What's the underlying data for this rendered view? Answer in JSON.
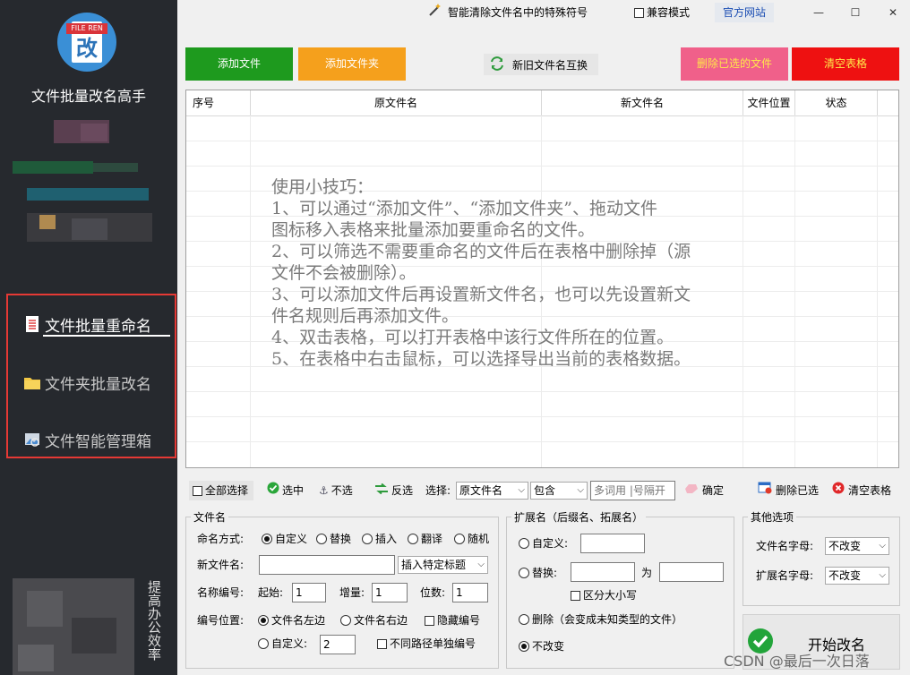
{
  "sidebar": {
    "logo_tag": "FILE REN",
    "logo_char": "改",
    "app_name": "文件批量改名高手",
    "nav": [
      {
        "label": "文件批量重命名"
      },
      {
        "label": "文件夹批量改名"
      },
      {
        "label": "文件智能管理箱"
      }
    ],
    "slogan": "提高办公效率"
  },
  "titlebar": {
    "special_chars": "智能清除文件名中的特殊符号",
    "compat_mode": "兼容模式",
    "official_site": "官方网站",
    "minimize": "—",
    "maximize": "☐",
    "close": "✕"
  },
  "actions": {
    "add_file": "添加文件",
    "add_folder": "添加文件夹",
    "swap_names": "新旧文件名互换",
    "delete_selected": "删除已选的文件",
    "clear_table": "清空表格",
    "colors": {
      "add_file": "#1e9a1e",
      "add_folder": "#f5a01c",
      "delete_selected": "#f0608a",
      "clear_table": "#ee1111"
    }
  },
  "table": {
    "columns": [
      "序号",
      "原文件名",
      "新文件名",
      "文件位置",
      "状态"
    ],
    "tips": [
      "使用小技巧：",
      "1、可以通过“添加文件”、“添加文件夹”、拖动文件",
      "图标移入表格来批量添加要重命名的文件。",
      "2、可以筛选不需要重命名的文件后在表格中删除掉（源",
      "文件不会被删除）。",
      "3、可以添加文件后再设置新文件名，也可以先设置新文",
      "件名规则后再添加文件。",
      "4、双击表格，可以打开表格中该行文件所在的位置。",
      "5、在表格中右击鼠标，可以选择导出当前的表格数据。"
    ]
  },
  "filterbar": {
    "select_all": "全部选择",
    "select": "选中",
    "deselect": "不选",
    "invert": "反选",
    "select_label": "选择:",
    "field_value": "原文件名",
    "match_value": "包含",
    "keyword_placeholder": "多词用 |号隔开",
    "confirm": "确定",
    "delete_checked": "删除已选",
    "clear_table": "清空表格"
  },
  "filename_group": {
    "title": "文件名",
    "mode_label": "命名方式:",
    "modes": [
      "自定义",
      "替换",
      "插入",
      "翻译",
      "随机"
    ],
    "mode_selected": "自定义",
    "new_name_label": "新文件名:",
    "new_name_value": "",
    "insert_title": "插入特定标题",
    "number_label": "名称编号:",
    "start_label": "起始:",
    "start_value": "1",
    "step_label": "增量:",
    "step_value": "1",
    "digits_label": "位数:",
    "digits_value": "1",
    "position_label": "编号位置:",
    "positions": [
      "文件名左边",
      "文件名右边"
    ],
    "hide_number": "隐藏编号",
    "custom": "自定义:",
    "custom_value": "2",
    "separate_path": "不同路径单独编号"
  },
  "ext_group": {
    "title": "扩展名（后缀名、拓展名）",
    "custom": "自定义:",
    "replace": "替换:",
    "to": "为",
    "case_sensitive": "区分大小写",
    "delete": "删除（会变成未知类型的文件）",
    "no_change": "不改变"
  },
  "other_group": {
    "title": "其他选项",
    "filename_font_label": "文件名字母:",
    "filename_font_value": "不改变",
    "ext_font_label": "扩展名字母:",
    "ext_font_value": "不改变"
  },
  "start_button": "开始改名",
  "watermark": "CSDN @最后一次日落"
}
